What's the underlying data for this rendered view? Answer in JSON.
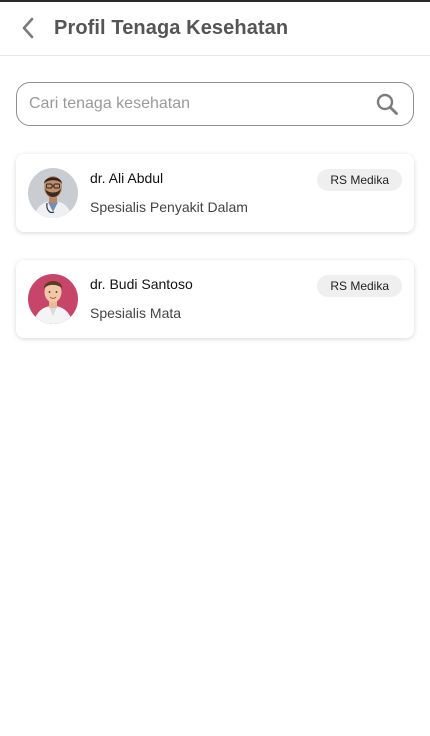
{
  "header": {
    "title": "Profil Tenaga Kesehatan",
    "back_icon": "chevron-left-icon"
  },
  "search": {
    "placeholder": "Cari tenaga kesehatan",
    "value": "",
    "icon": "search-icon"
  },
  "doctors": [
    {
      "name": "dr. Ali Abdul",
      "specialty": "Spesialis Penyakit Dalam",
      "hospital": "RS Medika",
      "avatar_bg": "#c9ccd1"
    },
    {
      "name": "dr. Budi Santoso",
      "specialty": "Spesialis Mata",
      "hospital": "RS Medika",
      "avatar_bg": "#c8456a"
    }
  ],
  "colors": {
    "title": "#555555",
    "search_border": "#8e8e8e",
    "badge_bg": "#efefef"
  }
}
